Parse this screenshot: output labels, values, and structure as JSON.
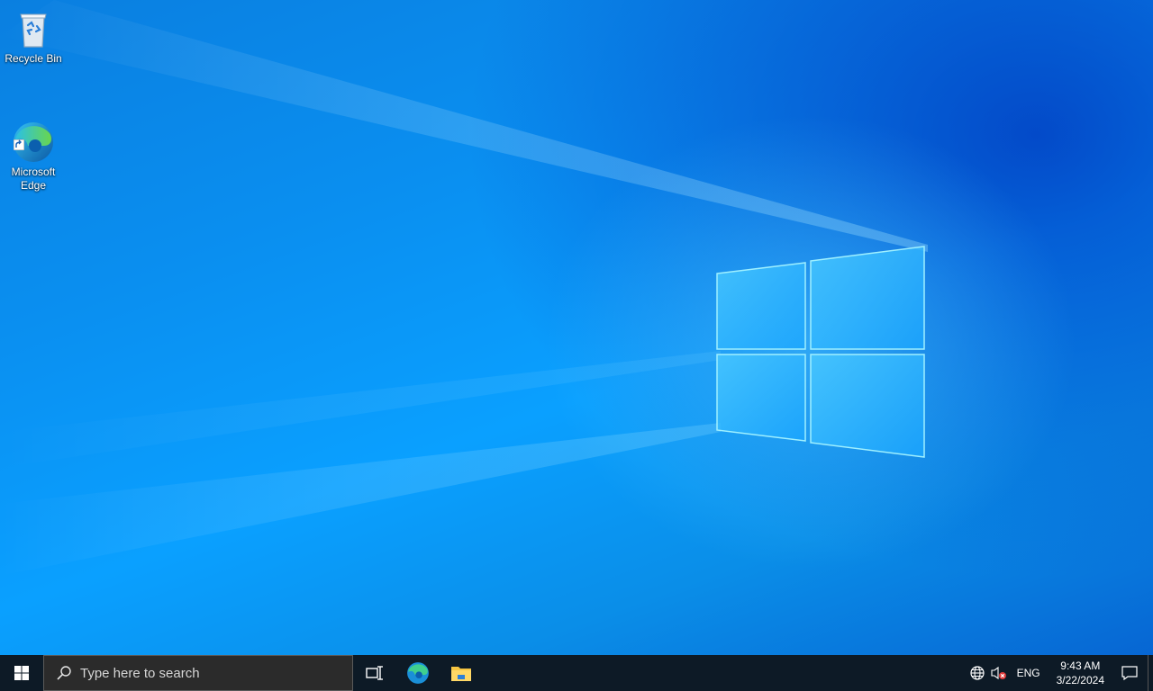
{
  "desktop": {
    "icons": [
      {
        "label": "Recycle Bin",
        "icon": "recycle-bin-icon"
      },
      {
        "label": "Microsoft\nEdge",
        "icon": "edge-icon"
      }
    ]
  },
  "taskbar": {
    "start_icon": "windows-logo-icon",
    "search_placeholder": "Type here to search",
    "pinned": [
      {
        "name": "task-view",
        "icon": "task-view-icon"
      },
      {
        "name": "edge",
        "icon": "edge-icon"
      },
      {
        "name": "file-explorer",
        "icon": "folder-icon"
      }
    ],
    "tray": {
      "network_icon": "globe-icon",
      "volume_icon": "speaker-muted-icon",
      "language": "ENG",
      "time": "9:43 AM",
      "date": "3/22/2024",
      "notifications_icon": "action-center-icon"
    }
  },
  "colors": {
    "wallpaper_primary": "#0a8ff0",
    "taskbar_bg": "#0d1a26",
    "search_bg": "#2b2b2b"
  }
}
